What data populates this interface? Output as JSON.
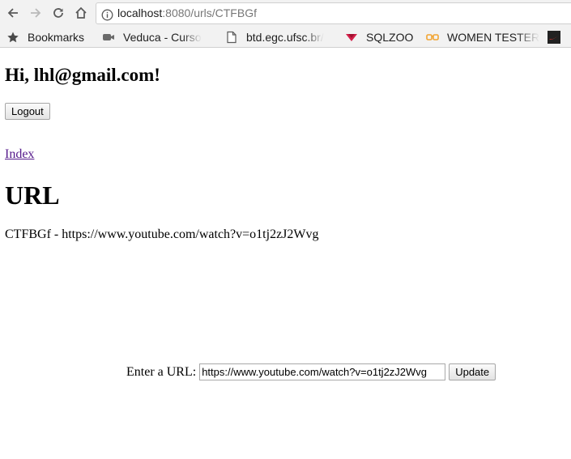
{
  "browser": {
    "address_host": "localhost",
    "address_rest": ":8080/urls/CTFBGf",
    "icons": {
      "back": "back-arrow-icon",
      "forward": "forward-arrow-icon",
      "reload": "reload-icon",
      "home": "home-icon",
      "info": "info-circle-icon"
    },
    "bookmarks": [
      {
        "label": "Bookmarks",
        "icon": "star-icon"
      },
      {
        "label": "Veduca - Curso",
        "icon": "video-camera-icon"
      },
      {
        "label": "btd.egc.ufsc.br/",
        "icon": "page-icon"
      },
      {
        "label": "SQLZOO",
        "icon": "sqlzoo-icon"
      },
      {
        "label": "WOMEN TESTER",
        "icon": "glasses-icon"
      },
      {
        "label": "",
        "icon": "nike-icon"
      }
    ]
  },
  "page": {
    "greeting": "Hi, lhl@gmail.com!",
    "logout_label": "Logout",
    "index_link": "Index",
    "heading": "URL",
    "url_line": "CTFBGf - https://www.youtube.com/watch?v=o1tj2zJ2Wvg",
    "form": {
      "label": "Enter a URL:",
      "input_value": "https://www.youtube.com/watch?v=o1tj2zJ2Wvg",
      "update_label": "Update"
    }
  },
  "colors": {
    "link_visited": "#551a8b",
    "chrome_bg": "#f2f2f2"
  }
}
